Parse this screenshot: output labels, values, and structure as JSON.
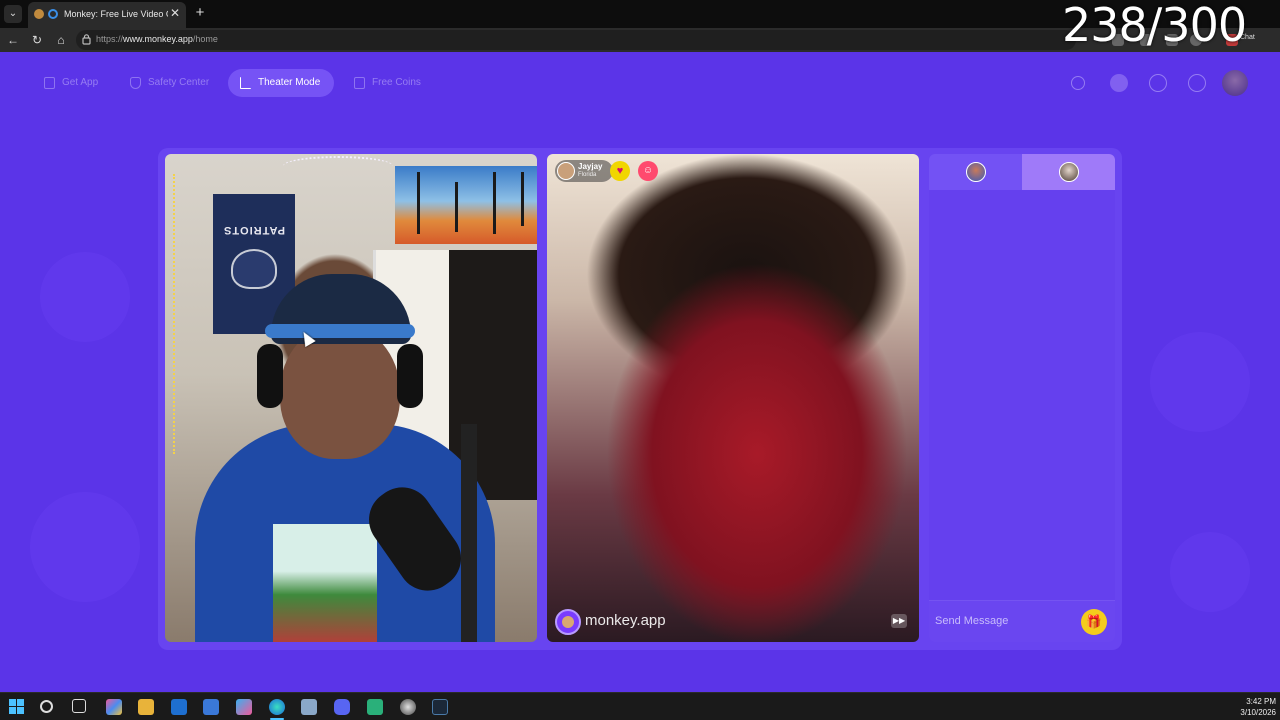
{
  "browser": {
    "tab_title": "Monkey: Free Live Video Chat",
    "tab_close": "✕",
    "new_tab": "+",
    "url_prefix": "https://",
    "url_domain": "www.monkey.app",
    "url_path": "/home",
    "ext_chat_label": "Chat"
  },
  "overlay": {
    "counter": "238/300"
  },
  "topnav": {
    "items": [
      {
        "label": "Get App",
        "icon": "phone-icon"
      },
      {
        "label": "Safety Center",
        "icon": "shield-icon"
      },
      {
        "label": "Theater Mode",
        "icon": "expand-icon",
        "active": true
      },
      {
        "label": "Free Coins",
        "icon": "coins-icon"
      }
    ],
    "right_icons": [
      "search-icon",
      "coin-avatar-icon",
      "history-icon",
      "messages-icon",
      "profile-avatar-icon"
    ]
  },
  "remote_user": {
    "name": "Jayjay",
    "location": "Florida"
  },
  "left_video": {
    "poster_text": "PATRIOTS"
  },
  "watermark": {
    "text": "monkey.app"
  },
  "chat": {
    "send_placeholder": "Send Message"
  },
  "taskbar": {
    "time": "3:42 PM",
    "date": "3/10/2026"
  },
  "colors": {
    "page_bg": "#5b34e8",
    "accent": "#7352f4",
    "gift": "#f4cc1c"
  }
}
